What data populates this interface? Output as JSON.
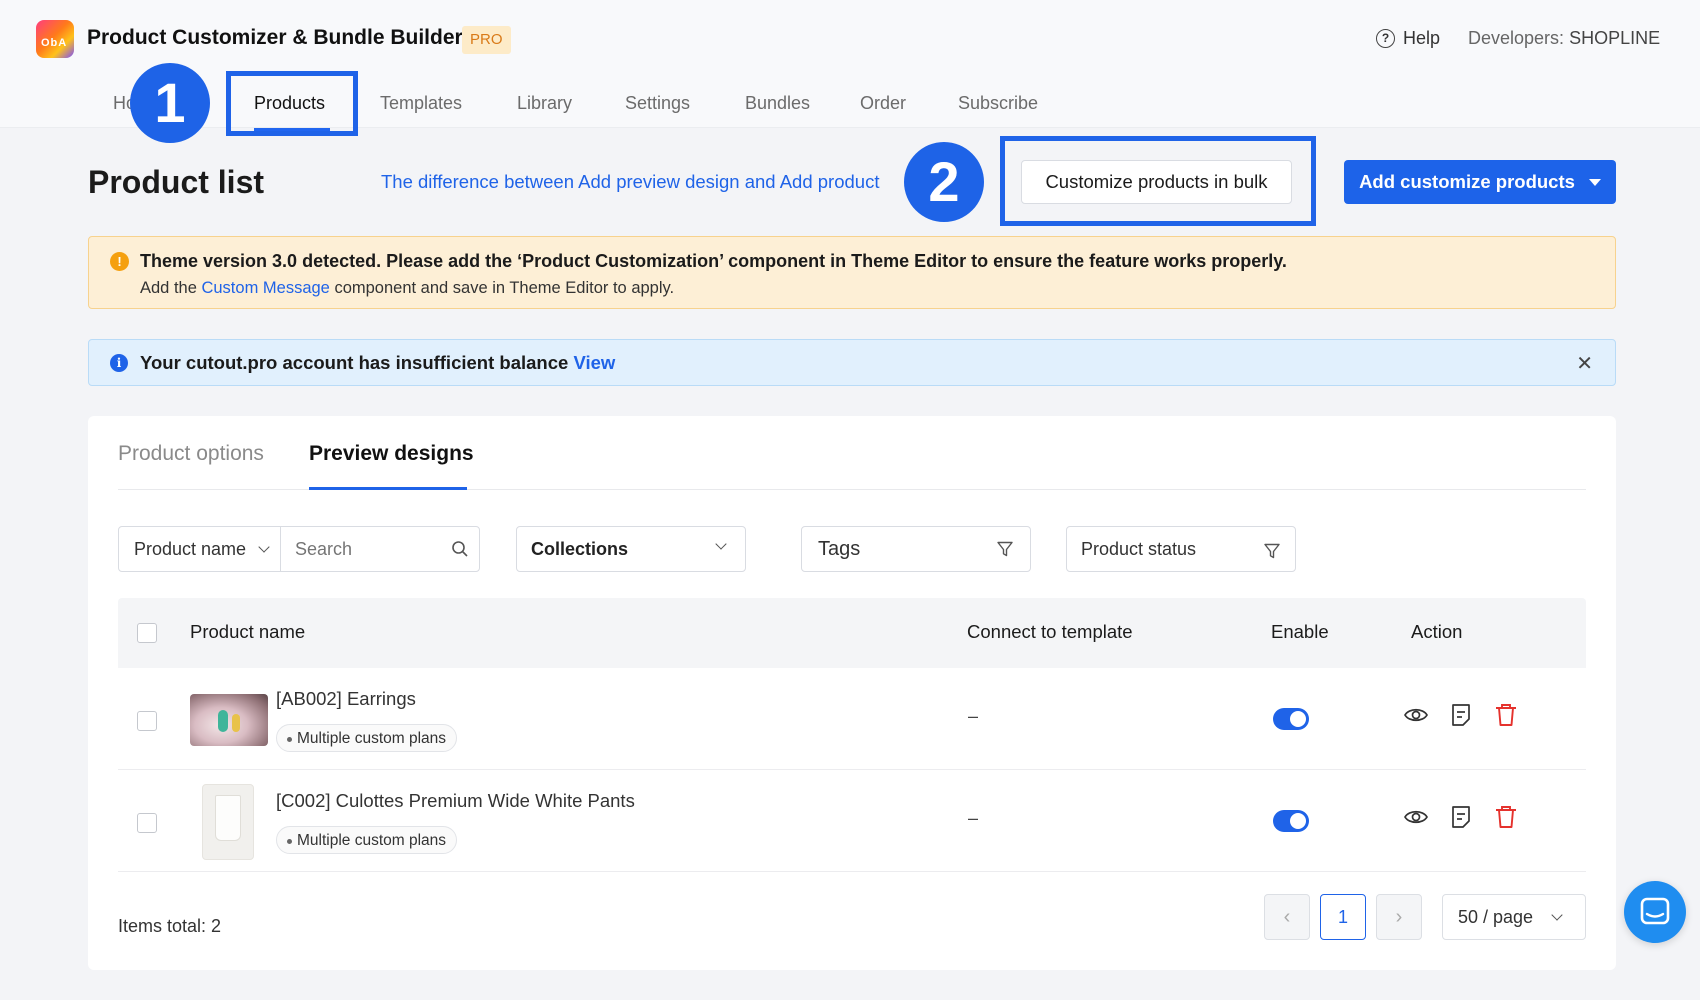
{
  "header": {
    "app_title": "Product Customizer & Bundle Builder",
    "badge": "PRO",
    "help_label": "Help",
    "developers_label": "Developers:",
    "developers_value": "SHOPLINE",
    "logo_text": "ObA"
  },
  "nav": {
    "items": [
      {
        "label": "Ho"
      },
      {
        "label": "Products"
      },
      {
        "label": "Templates"
      },
      {
        "label": "Library"
      },
      {
        "label": "Settings"
      },
      {
        "label": "Bundles"
      },
      {
        "label": "Order"
      },
      {
        "label": "Subscribe"
      }
    ],
    "active": "Products"
  },
  "markers": [
    "1",
    "2"
  ],
  "page": {
    "title": "Product list",
    "diff_link": "The difference between Add preview design and Add product",
    "bulk_button": "Customize products in bulk",
    "add_button": "Add customize products"
  },
  "warning": {
    "main": "Theme version 3.0 detected. Please add the ‘Product Customization’ component in Theme Editor to ensure the feature works properly.",
    "sub_before": "Add the ",
    "sub_link": "Custom Message",
    "sub_after": " component and save in Theme Editor to apply."
  },
  "info": {
    "text": "Your cutout.pro account has insufficient balance ",
    "link": "View"
  },
  "tabs": [
    {
      "label": "Product options",
      "active": false
    },
    {
      "label": "Preview designs",
      "active": true
    }
  ],
  "filters": {
    "field_select": "Product name",
    "search_placeholder": "Search",
    "collections": "Collections",
    "tags": "Tags",
    "status": "Product status"
  },
  "table": {
    "columns": [
      "Product name",
      "Connect to template",
      "Enable",
      "Action"
    ],
    "rows": [
      {
        "name": "[AB002] Earrings",
        "tag": "Multiple custom plans",
        "template": "–",
        "enabled": true
      },
      {
        "name": "[C002] Culottes Premium Wide White Pants",
        "tag": "Multiple custom plans",
        "template": "–",
        "enabled": true
      }
    ]
  },
  "pagination": {
    "total_label": "Items total: 2",
    "current_page": "1",
    "page_size": "50 / page"
  },
  "colors": {
    "accent": "#1f63e8",
    "warning_bg": "#fdefd6",
    "info_bg": "#e1f0fd",
    "danger": "#e5322d"
  },
  "icons": [
    "help-icon",
    "search-icon",
    "chevron-down-icon",
    "filter-icon",
    "eye-icon",
    "document-icon",
    "trash-icon",
    "close-icon",
    "chat-icon"
  ]
}
